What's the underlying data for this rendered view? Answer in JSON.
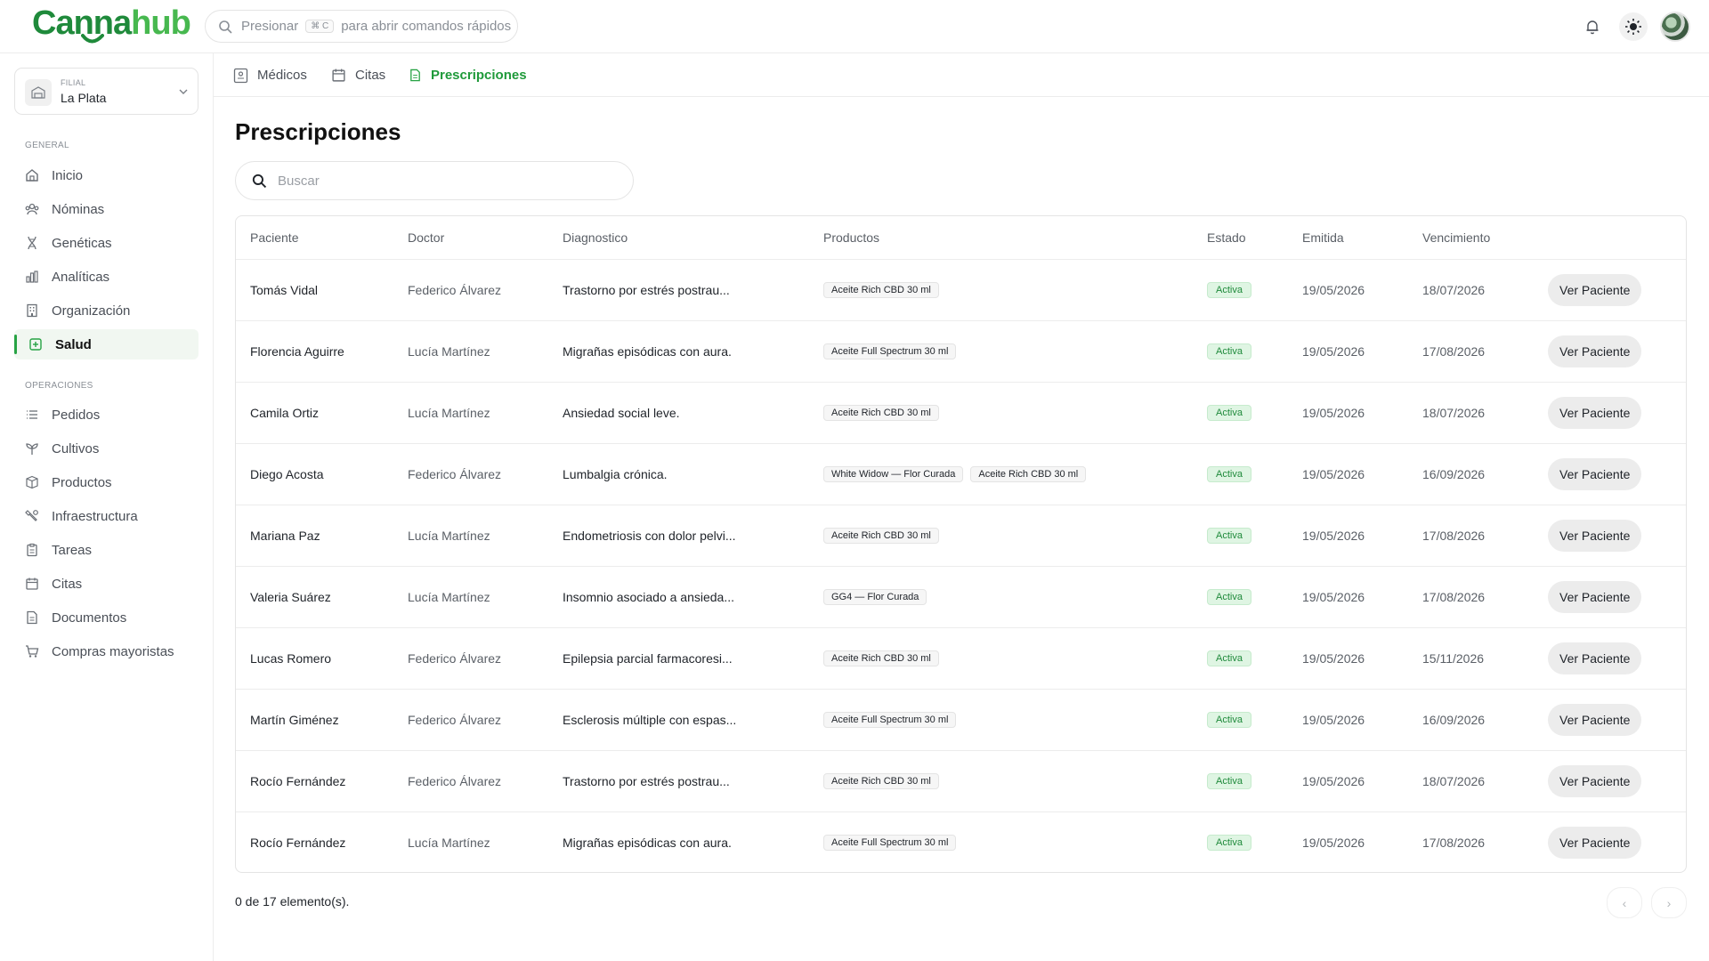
{
  "brand": {
    "name_part1": "Canna",
    "name_part2": "hub"
  },
  "quick_search": {
    "prefix": "Presionar",
    "shortcut": "⌘ C",
    "suffix": "para abrir comandos rápidos"
  },
  "header_icons": [
    "bell-icon",
    "sun-icon",
    "user-avatar"
  ],
  "branch": {
    "caption": "FILIAL",
    "value": "La Plata"
  },
  "sidebar": {
    "general_title": "GENERAL",
    "general_items": [
      {
        "label": "Inicio",
        "icon": "home-icon"
      },
      {
        "label": "Nóminas",
        "icon": "users-icon"
      },
      {
        "label": "Genéticas",
        "icon": "dna-icon"
      },
      {
        "label": "Analíticas",
        "icon": "chart-icon"
      },
      {
        "label": "Organización",
        "icon": "building-icon"
      },
      {
        "label": "Salud",
        "icon": "health-icon",
        "active": true
      }
    ],
    "ops_title": "OPERACIONES",
    "ops_items": [
      {
        "label": "Pedidos",
        "icon": "list-icon"
      },
      {
        "label": "Cultivos",
        "icon": "sprout-icon"
      },
      {
        "label": "Productos",
        "icon": "package-icon"
      },
      {
        "label": "Infraestructura",
        "icon": "tools-icon"
      },
      {
        "label": "Tareas",
        "icon": "clipboard-icon"
      },
      {
        "label": "Citas",
        "icon": "calendar-icon"
      },
      {
        "label": "Documentos",
        "icon": "document-icon"
      },
      {
        "label": "Compras mayoristas",
        "icon": "cart-icon"
      }
    ]
  },
  "tabs": [
    {
      "label": "Médicos",
      "icon": "doctor-icon"
    },
    {
      "label": "Citas",
      "icon": "calendar-icon"
    },
    {
      "label": "Prescripciones",
      "icon": "document-icon",
      "active": true
    }
  ],
  "page": {
    "title": "Prescripciones",
    "search_placeholder": "Buscar"
  },
  "table": {
    "columns": [
      "Paciente",
      "Doctor",
      "Diagnostico",
      "Productos",
      "Estado",
      "Emitida",
      "Vencimiento",
      ""
    ],
    "action_label": "Ver Paciente",
    "rows": [
      {
        "patient": "Tomás Vidal",
        "doctor": "Federico Álvarez",
        "diagnosis": "Trastorno por estrés postrau...",
        "products": [
          "Aceite Rich CBD 30 ml"
        ],
        "status": "Activa",
        "issued": "19/05/2026",
        "expires": "18/07/2026"
      },
      {
        "patient": "Florencia Aguirre",
        "doctor": "Lucía Martínez",
        "diagnosis": "Migrañas episódicas con aura.",
        "products": [
          "Aceite Full Spectrum 30 ml"
        ],
        "status": "Activa",
        "issued": "19/05/2026",
        "expires": "17/08/2026"
      },
      {
        "patient": "Camila Ortiz",
        "doctor": "Lucía Martínez",
        "diagnosis": "Ansiedad social leve.",
        "products": [
          "Aceite Rich CBD 30 ml"
        ],
        "status": "Activa",
        "issued": "19/05/2026",
        "expires": "18/07/2026"
      },
      {
        "patient": "Diego Acosta",
        "doctor": "Federico Álvarez",
        "diagnosis": "Lumbalgia crónica.",
        "products": [
          "White Widow — Flor Curada",
          "Aceite Rich CBD 30 ml"
        ],
        "status": "Activa",
        "issued": "19/05/2026",
        "expires": "16/09/2026"
      },
      {
        "patient": "Mariana Paz",
        "doctor": "Lucía Martínez",
        "diagnosis": "Endometriosis con dolor pelvi...",
        "products": [
          "Aceite Rich CBD 30 ml"
        ],
        "status": "Activa",
        "issued": "19/05/2026",
        "expires": "17/08/2026"
      },
      {
        "patient": "Valeria Suárez",
        "doctor": "Lucía Martínez",
        "diagnosis": "Insomnio asociado a ansieda...",
        "products": [
          "GG4 — Flor Curada"
        ],
        "status": "Activa",
        "issued": "19/05/2026",
        "expires": "17/08/2026"
      },
      {
        "patient": "Lucas Romero",
        "doctor": "Federico Álvarez",
        "diagnosis": "Epilepsia parcial farmacoresi...",
        "products": [
          "Aceite Rich CBD 30 ml"
        ],
        "status": "Activa",
        "issued": "19/05/2026",
        "expires": "15/11/2026"
      },
      {
        "patient": "Martín Giménez",
        "doctor": "Federico Álvarez",
        "diagnosis": "Esclerosis múltiple con espas...",
        "products": [
          "Aceite Full Spectrum 30 ml"
        ],
        "status": "Activa",
        "issued": "19/05/2026",
        "expires": "16/09/2026"
      },
      {
        "patient": "Rocío Fernández",
        "doctor": "Federico Álvarez",
        "diagnosis": "Trastorno por estrés postrau...",
        "products": [
          "Aceite Rich CBD 30 ml"
        ],
        "status": "Activa",
        "issued": "19/05/2026",
        "expires": "18/07/2026"
      },
      {
        "patient": "Rocío Fernández",
        "doctor": "Lucía Martínez",
        "diagnosis": "Migrañas episódicas con aura.",
        "products": [
          "Aceite Full Spectrum 30 ml"
        ],
        "status": "Activa",
        "issued": "19/05/2026",
        "expires": "17/08/2026"
      }
    ]
  },
  "footer": {
    "count_text": "0 de 17 elemento(s).",
    "prev": "‹",
    "next": "›"
  },
  "colors": {
    "accent": "#27a344",
    "brand_dark": "#1f8a3b",
    "brand_light": "#47b84f",
    "status_bg": "#dff5e3"
  }
}
